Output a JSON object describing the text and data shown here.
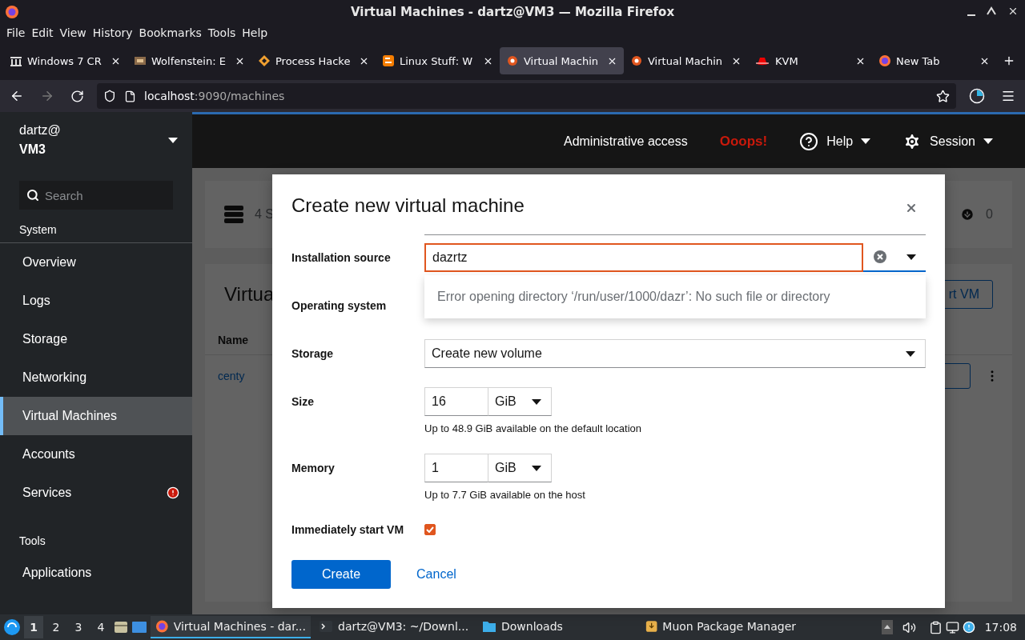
{
  "window": {
    "title": "Virtual Machines - dartz@VM3 — Mozilla Firefox"
  },
  "menu": [
    "File",
    "Edit",
    "View",
    "History",
    "Bookmarks",
    "Tools",
    "Help"
  ],
  "tabs": [
    {
      "label": "Windows 7 CR",
      "kind": "columns",
      "selected": false
    },
    {
      "label": "Wolfenstein: E",
      "kind": "game",
      "selected": false
    },
    {
      "label": "Process Hacke",
      "kind": "diamond",
      "selected": false
    },
    {
      "label": "Linux Stuff: W",
      "kind": "blog",
      "selected": false
    },
    {
      "label": "Virtual Machin",
      "kind": "cockpit",
      "selected": true
    },
    {
      "label": "Virtual Machin",
      "kind": "cockpit",
      "selected": false
    },
    {
      "label": "KVM",
      "kind": "hat",
      "selected": false
    },
    {
      "label": "New Tab",
      "kind": "firefox",
      "selected": false
    }
  ],
  "address": {
    "host": "localhost",
    "path": ":9090/machines"
  },
  "header": {
    "user": "dartz@",
    "host": "VM3",
    "admin": "Administrative access",
    "alert": "Ooops!",
    "help": "Help",
    "session": "Session"
  },
  "sidebar": {
    "search": {
      "placeholder": "Search"
    },
    "sections": [
      {
        "title": "System",
        "items": [
          {
            "label": "Overview",
            "selected": false,
            "alert": false
          },
          {
            "label": "Logs",
            "selected": false,
            "alert": false
          },
          {
            "label": "Storage",
            "selected": false,
            "alert": false
          },
          {
            "label": "Networking",
            "selected": false,
            "alert": false
          },
          {
            "label": "Virtual Machines",
            "selected": true,
            "alert": false
          },
          {
            "label": "Accounts",
            "selected": false,
            "alert": false
          },
          {
            "label": "Services",
            "selected": false,
            "alert": true
          }
        ]
      },
      {
        "title": "Tools",
        "items": [
          {
            "label": "Applications",
            "selected": false,
            "alert": false
          }
        ]
      }
    ]
  },
  "background": {
    "summary": "4 S",
    "count": "0",
    "card_title": "Virtua",
    "button": "rt VM",
    "column": "Name",
    "row": "centy"
  },
  "dialog": {
    "title": "Create new virtual machine",
    "fields": [
      {
        "kind": "combo",
        "label": "Installation source",
        "value": "dazrtz"
      },
      {
        "kind": "blank",
        "label": "Operating system"
      },
      {
        "kind": "select",
        "label": "Storage",
        "value": "Create new volume"
      },
      {
        "kind": "size",
        "label": "Size",
        "value": "16",
        "unit": "GiB",
        "help": "Up to 48.9 GiB available on the default location"
      },
      {
        "kind": "size",
        "label": "Memory",
        "value": "1",
        "unit": "GiB",
        "help": "Up to 7.7 GiB available on the host"
      },
      {
        "kind": "checkbox",
        "label": "Immediately start VM",
        "checked": true
      }
    ],
    "popup": "Error opening directory ‘/run/user/1000/dazr’: No such file or directory",
    "primary": "Create",
    "secondary": "Cancel"
  },
  "taskbar": {
    "workspaces": [
      {
        "label": "1",
        "selected": true
      },
      {
        "label": "2",
        "selected": false
      },
      {
        "label": "3",
        "selected": false
      },
      {
        "label": "4",
        "selected": false
      }
    ],
    "tasks": [
      {
        "label": "Virtual Machines - dar...",
        "kind": "firefox",
        "selected": true
      },
      {
        "label": "dartz@VM3: ~/Downl...",
        "kind": "terminal",
        "selected": false
      },
      {
        "label": "Downloads",
        "kind": "folder",
        "selected": false
      },
      {
        "label": "Muon Package Manager",
        "kind": "package",
        "selected": false
      }
    ],
    "clock": "17:08"
  }
}
